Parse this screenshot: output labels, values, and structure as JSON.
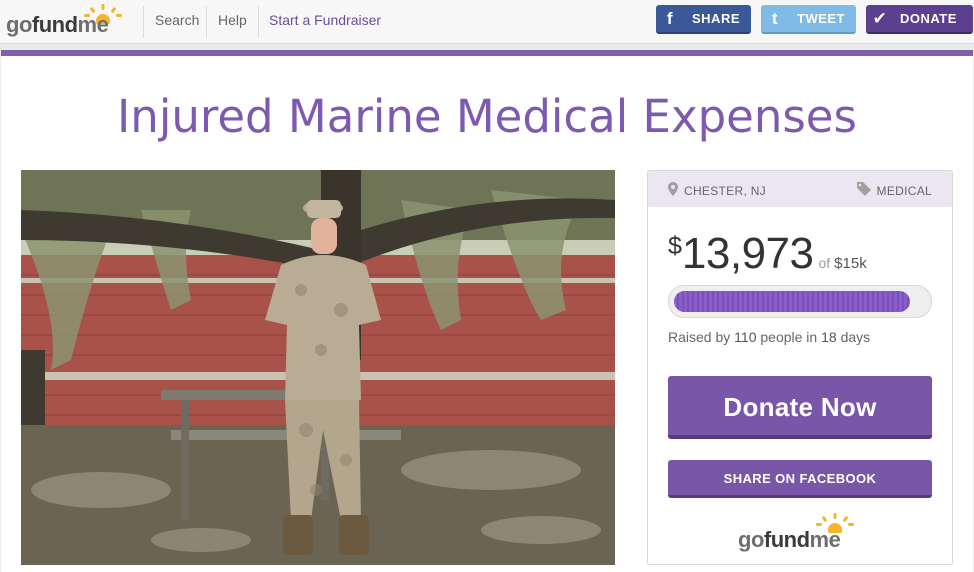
{
  "nav": {
    "logo": {
      "go": "go",
      "fund": "fund",
      "me": "me"
    },
    "links": [
      "Search",
      "Help",
      "Start a Fundraiser"
    ],
    "share_label": "SHARE",
    "tweet_label": "TWEET",
    "donate_label": "DONATE",
    "colors": {
      "facebook": "#3b5998",
      "twitter": "#7fbbe6",
      "donate": "#5d3f8f"
    }
  },
  "campaign": {
    "title": "Injured Marine Medical Expenses",
    "location": "CHESTER, NJ",
    "category": "MEDICAL",
    "currency": "$",
    "raised": "13,973",
    "of_label": "of",
    "goal": "$15k",
    "progress_fraction": 0.93,
    "stats": {
      "prefix": "Raised by",
      "people": "110",
      "middle": "people in",
      "days": "18",
      "suffix": "days"
    },
    "donate_now_label": "Donate Now",
    "share_facebook_label": "SHARE ON FACEBOOK",
    "accent_color": "#7a56a8"
  },
  "icons": {
    "location": "map-pin-icon",
    "category": "tag-icon",
    "facebook": "facebook-icon",
    "twitter": "twitter-icon",
    "donate": "checkmark-icon"
  }
}
